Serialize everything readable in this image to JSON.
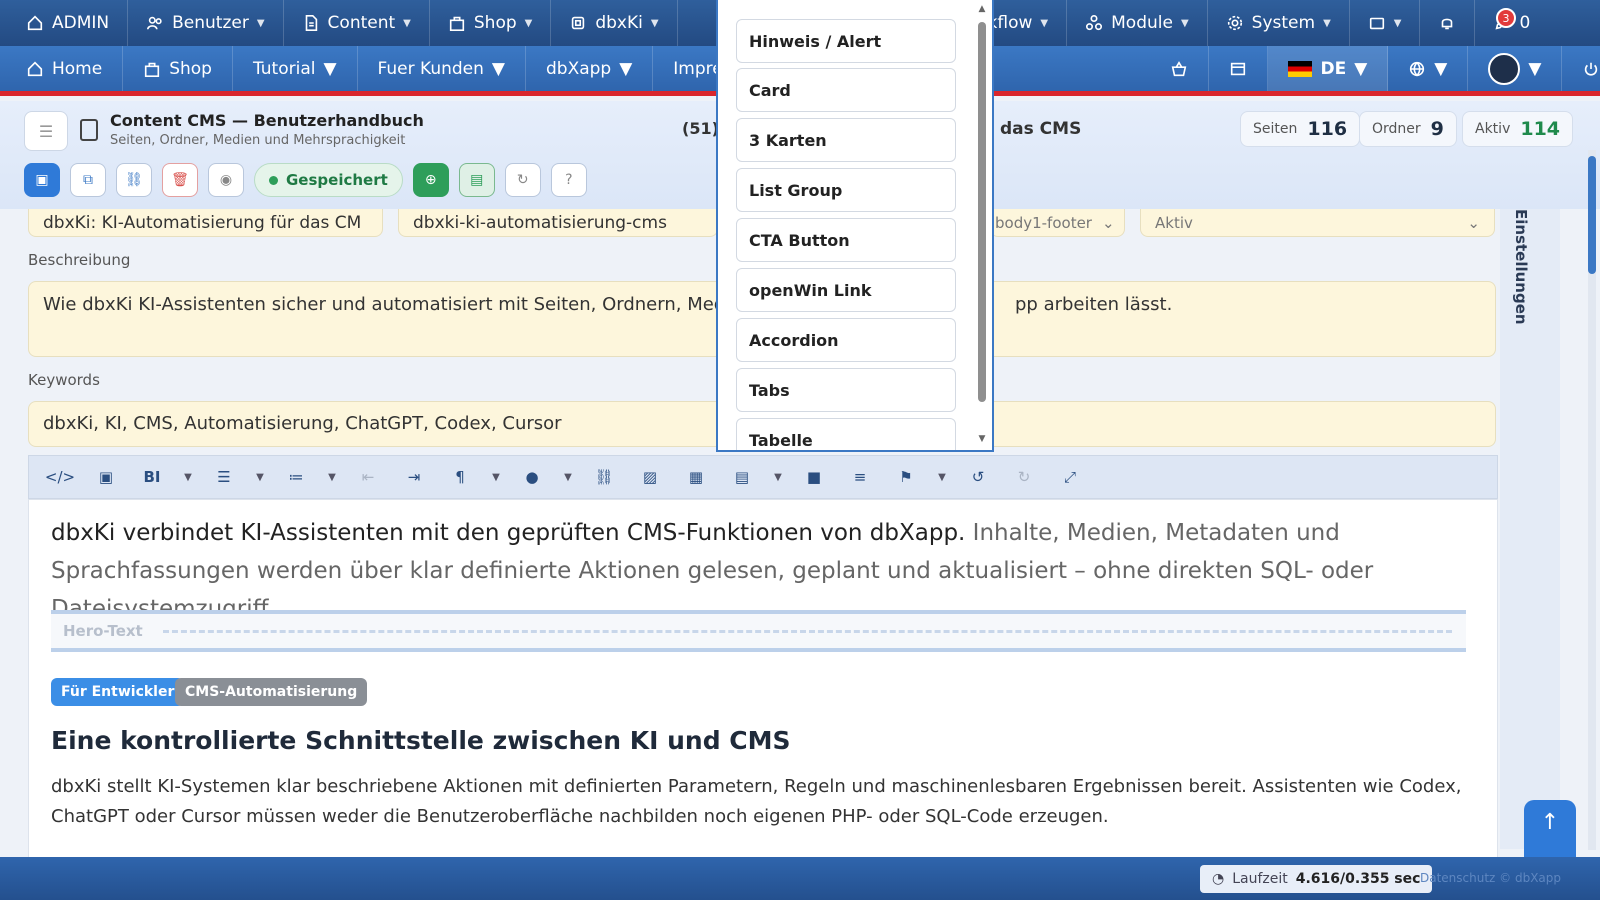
{
  "topbar": {
    "items": [
      {
        "label": "ADMIN",
        "icon": "home-icon"
      },
      {
        "label": "Benutzer",
        "icon": "users-icon"
      },
      {
        "label": "Content",
        "icon": "document-icon"
      },
      {
        "label": "Shop",
        "icon": "bag-icon"
      },
      {
        "label": "dbxKi",
        "icon": "chip-icon"
      },
      {
        "label": "rkflow",
        "icon": "workflow-icon"
      },
      {
        "label": "Module",
        "icon": "modules-icon"
      },
      {
        "label": "System",
        "icon": "gear-icon"
      }
    ],
    "notifications_count": "3",
    "edit_count": "0"
  },
  "subbar": {
    "items": [
      {
        "label": "Home",
        "icon": "home-icon"
      },
      {
        "label": "Shop",
        "icon": "bag-icon"
      },
      {
        "label": "Tutorial"
      },
      {
        "label": "Fuer Kunden"
      },
      {
        "label": "dbXapp"
      },
      {
        "label": "Impress"
      }
    ],
    "language": "DE"
  },
  "page": {
    "title": "Content CMS — Benutzerhandbuch",
    "subtitle": "Seiten, Ordner, Medien und Mehrsprachigkeit",
    "count": "(51)",
    "cms_text": "das CMS",
    "stats": [
      {
        "label": "Seiten",
        "value": "116"
      },
      {
        "label": "Ordner",
        "value": "9"
      },
      {
        "label": "Aktiv",
        "value": "114"
      }
    ],
    "saved_label": "Gespeichert"
  },
  "form": {
    "title_value": "dbxKi: KI-Automatisierung für das CM",
    "slug_value": "dbxki-ki-automatisierung-cms",
    "template_value": "body1-footer",
    "status_value": "Aktiv",
    "description_label": "Beschreibung",
    "description_left": "Wie dbxKi KI-Assistenten sicher und automatisiert mit Seiten, Ordnern, Medi",
    "description_right": "pp arbeiten lässt.",
    "keywords_label": "Keywords",
    "keywords_value": "dbxKi, KI, CMS, Automatisierung, ChatGPT, Codex, Cursor"
  },
  "editor": {
    "lead_strong": "dbxKi verbindet KI-Assistenten mit den geprüften CMS-Funktionen von dbXapp.",
    "lead_muted": " Inhalte, Medien, Metadaten und Sprachfassungen werden über klar definierte Aktionen gelesen, geplant und aktualisiert – ohne direkten SQL- oder Dateisystemzugriff.",
    "hero_label": "Hero-Text",
    "tags": [
      "Für Entwickler",
      "CMS-Automatisierung"
    ],
    "heading": "Eine kontrollierte Schnittstelle zwischen KI und CMS",
    "paragraph": "dbxKi stellt KI-Systemen klar beschriebene Aktionen mit definierten Parametern, Regeln und maschinenlesbaren Ergebnissen bereit. Assistenten wie Codex, ChatGPT oder Cursor müssen weder die Benutzeroberfläche nachbilden noch eigenen PHP- oder SQL-Code erzeugen."
  },
  "sidebar_right": {
    "label": "Einstellungen"
  },
  "popup": {
    "items": [
      "Hinweis / Alert",
      "Card",
      "3 Karten",
      "List Group",
      "CTA Button",
      "openWin Link",
      "Accordion",
      "Tabs",
      "Tabelle"
    ]
  },
  "footer": {
    "runtime_label": "Laufzeit",
    "runtime_value": "4.616/0.355 sec",
    "links": "Datenschutz  © dbXapp"
  },
  "colors": {
    "accent": "#2f7ad8",
    "topbar": "#2f5f9c",
    "danger": "#d9262c",
    "field_bg": "#fdf6dc"
  }
}
